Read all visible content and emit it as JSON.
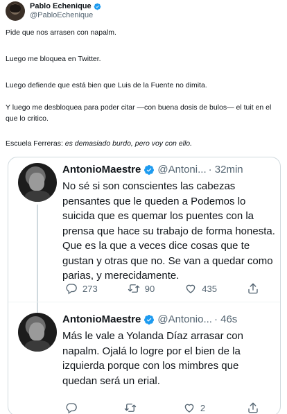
{
  "tweet": {
    "author": {
      "display_name": "Pablo Echenique",
      "handle": "@PabloEchenique"
    },
    "paragraphs": [
      "Pide que nos arrasen con napalm.",
      "Luego me bloquea en Twitter.",
      "Luego defiende que está bien que Luis de la Fuente no dimita.",
      "Y luego me desbloquea para poder citar —con buena dosis de bulos— el tuit en el que lo critico."
    ],
    "last_line_prefix": "Escuela Ferreras: ",
    "last_line_italic": "es demasiado burdo, pero voy con ello."
  },
  "quoted_thread": [
    {
      "name": "AntonioMaestre",
      "handle": "@Antoni...",
      "time": "· 32min",
      "text": "No sé si son conscientes las cabezas pensantes que le queden a Podemos lo suicida que es quemar los puentes con la prensa que hace su trabajo de forma honesta. Que es la que a veces dice cosas que te gustan y otras que no. Se van a quedar como parias, y merecidamente.",
      "replies": "273",
      "retweets": "90",
      "likes": "435"
    },
    {
      "name": "AntonioMaestre",
      "handle": "@Antonio...",
      "time": "· 46s",
      "text": "Más le vale a Yolanda Díaz arrasar con napalm. Ojalá lo logre por el bien de la izquierda porque con los mimbres que quedan será un erial.",
      "replies": "",
      "retweets": "",
      "likes": "2"
    }
  ],
  "colors": {
    "verified": "#1d9bf0",
    "secondary_text": "#536471",
    "border": "#cfd9de"
  },
  "icons": [
    "verified-badge-icon",
    "reply-icon",
    "retweet-icon",
    "like-icon",
    "share-icon"
  ]
}
